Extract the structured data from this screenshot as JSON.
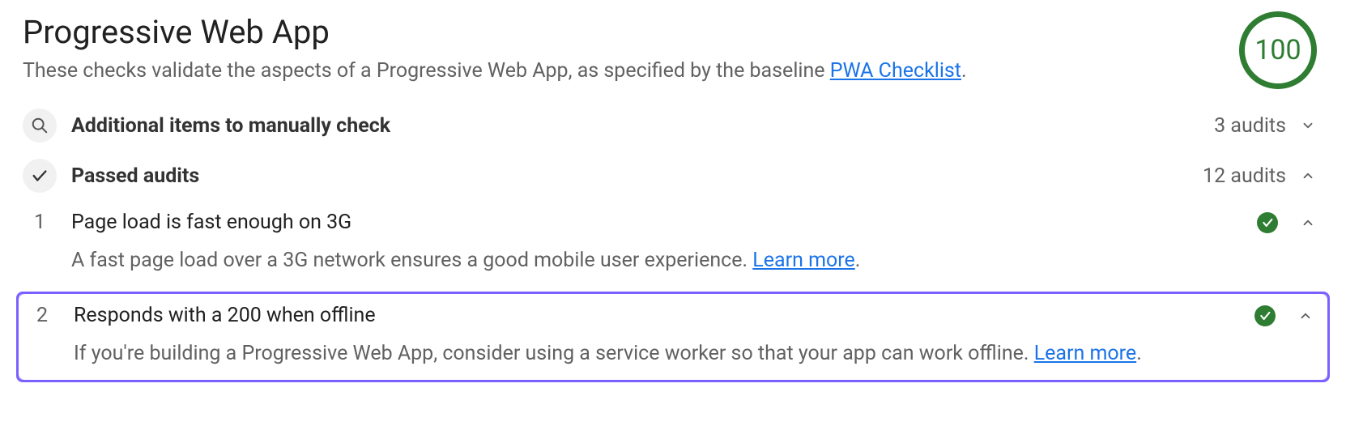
{
  "header": {
    "title": "Progressive Web App",
    "subtitle_prefix": "These checks validate the aspects of a Progressive Web App, as specified by the baseline ",
    "subtitle_link": "PWA Checklist",
    "subtitle_suffix": ".",
    "score": "100"
  },
  "sections": {
    "manual": {
      "title": "Additional items to manually check",
      "count": "3 audits",
      "expanded": false
    },
    "passed": {
      "title": "Passed audits",
      "count": "12 audits",
      "expanded": true
    }
  },
  "audits": [
    {
      "index": "1",
      "title": "Page load is fast enough on 3G",
      "description_prefix": "A fast page load over a 3G network ensures a good mobile user experience. ",
      "learn_more": "Learn more",
      "description_suffix": ".",
      "highlighted": false
    },
    {
      "index": "2",
      "title": "Responds with a 200 when offline",
      "description_prefix": "If you're building a Progressive Web App, consider using a service worker so that your app can work offline. ",
      "learn_more": "Learn more",
      "description_suffix": ".",
      "highlighted": true
    }
  ]
}
